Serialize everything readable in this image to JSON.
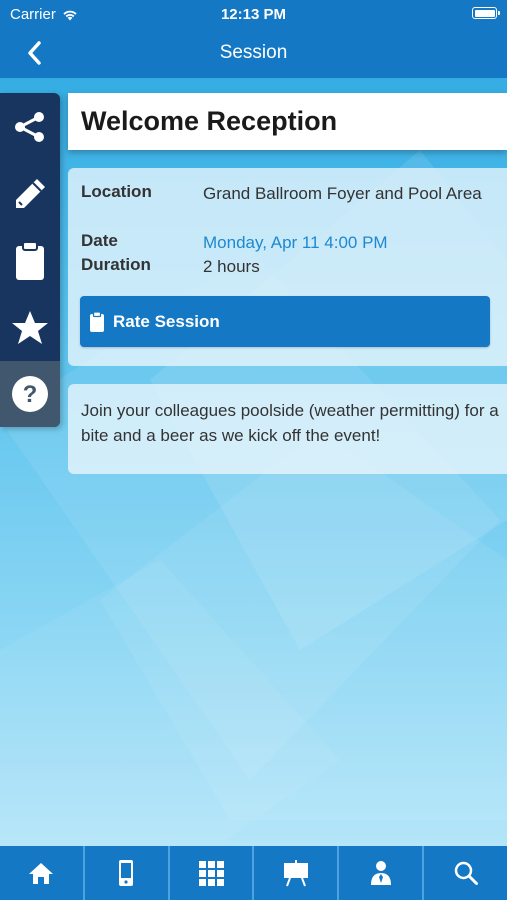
{
  "status_bar": {
    "carrier": "Carrier",
    "time": "12:13 PM"
  },
  "nav": {
    "title": "Session",
    "back_icon": "chevron-left-icon"
  },
  "side_menu": {
    "items": [
      {
        "icon": "share-icon"
      },
      {
        "icon": "pencil-icon"
      },
      {
        "icon": "clipboard-icon"
      },
      {
        "icon": "star-icon"
      },
      {
        "icon": "help-icon"
      }
    ]
  },
  "session": {
    "title": "Welcome Reception",
    "location_label": "Location",
    "location_value": "Grand Ballroom Foyer and Pool Area",
    "date_label": "Date",
    "date_value": "Monday, Apr 11 4:00 PM",
    "duration_label": "Duration",
    "duration_value": "2 hours",
    "rate_button": "Rate Session",
    "description": "Join your colleagues poolside (weather permitting) for a bite and a beer as we kick off the event!"
  },
  "tab_bar": {
    "tabs": [
      {
        "icon": "home-icon"
      },
      {
        "icon": "mobile-icon"
      },
      {
        "icon": "qr-code-icon"
      },
      {
        "icon": "presentation-icon"
      },
      {
        "icon": "speaker-icon"
      },
      {
        "icon": "search-icon"
      }
    ]
  },
  "colors": {
    "primary": "#1478c4",
    "side_menu": "#17355f",
    "link": "#1e88d0"
  }
}
